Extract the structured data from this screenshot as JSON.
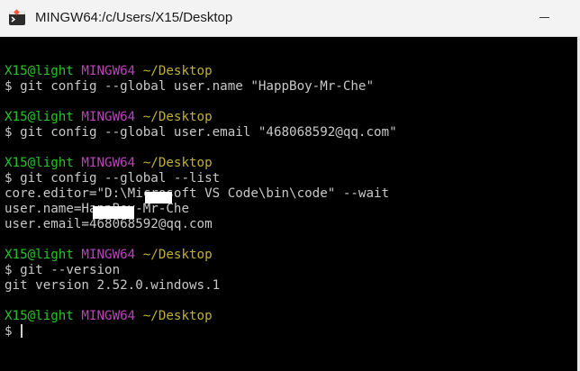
{
  "window": {
    "title": "MINGW64:/c/Users/X15/Desktop",
    "icon": "git-bash-icon"
  },
  "colors": {
    "prompt_user": "#26c526",
    "prompt_env": "#c040c0",
    "prompt_path": "#c0b030",
    "output": "#c8c8c8",
    "background": "#000000"
  },
  "terminal": {
    "lines": [
      {
        "segments": []
      },
      {
        "segments": [
          {
            "text": "X15@light ",
            "color": "green"
          },
          {
            "text": "MINGW64 ",
            "color": "magenta"
          },
          {
            "text": "~/Desktop",
            "color": "yellow"
          }
        ]
      },
      {
        "segments": [
          {
            "text": "$ git config --global user.name \"HappBoy-Mr-Che\"",
            "color": "white"
          }
        ]
      },
      {
        "segments": []
      },
      {
        "segments": [
          {
            "text": "X15@light ",
            "color": "green"
          },
          {
            "text": "MINGW64 ",
            "color": "magenta"
          },
          {
            "text": "~/Desktop",
            "color": "yellow"
          }
        ]
      },
      {
        "segments": [
          {
            "text": "$ git config --global user.email \"468068592@qq.com\"",
            "color": "white"
          }
        ]
      },
      {
        "segments": []
      },
      {
        "segments": [
          {
            "text": "X15@light ",
            "color": "green"
          },
          {
            "text": "MINGW64 ",
            "color": "magenta"
          },
          {
            "text": "~/Desktop",
            "color": "yellow"
          }
        ]
      },
      {
        "segments": [
          {
            "text": "$ git config --global --list",
            "color": "white"
          }
        ]
      },
      {
        "segments": [
          {
            "text": "core.editor=\"D:\\Microsoft VS Code\\bin\\code\" --wait",
            "color": "white"
          }
        ]
      },
      {
        "segments": [
          {
            "text": "user.name=HappBoy-Mr-Che",
            "color": "white"
          }
        ]
      },
      {
        "segments": [
          {
            "text": "user.email=468068592@qq.com",
            "color": "white"
          }
        ]
      },
      {
        "segments": []
      },
      {
        "segments": [
          {
            "text": "X15@light ",
            "color": "green"
          },
          {
            "text": "MINGW64 ",
            "color": "magenta"
          },
          {
            "text": "~/Desktop",
            "color": "yellow"
          }
        ]
      },
      {
        "segments": [
          {
            "text": "$ git --version",
            "color": "white"
          }
        ]
      },
      {
        "segments": [
          {
            "text": "git version 2.52.0.windows.1",
            "color": "white"
          }
        ]
      },
      {
        "segments": []
      },
      {
        "segments": [
          {
            "text": "X15@light ",
            "color": "green"
          },
          {
            "text": "MINGW64 ",
            "color": "magenta"
          },
          {
            "text": "~/Desktop",
            "color": "yellow"
          }
        ]
      },
      {
        "segments": [
          {
            "text": "$ ",
            "color": "white"
          }
        ],
        "cursor": true
      }
    ]
  }
}
